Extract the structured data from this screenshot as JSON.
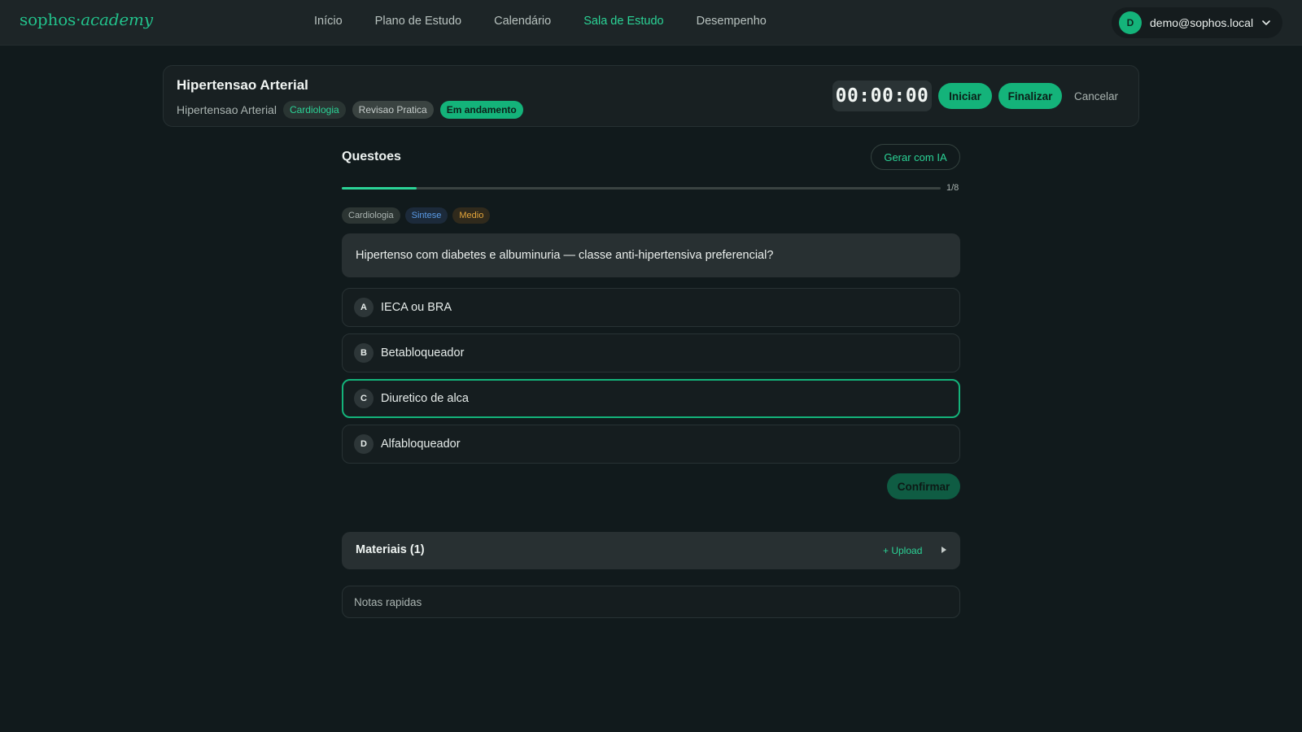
{
  "app": {
    "logo_main": "sophos",
    "logo_sep": "·",
    "logo_accent": "academy"
  },
  "nav": {
    "items": [
      "Início",
      "Plano de Estudo",
      "Calendário",
      "Sala de Estudo",
      "Desempenho"
    ],
    "active": "Sala de Estudo"
  },
  "user": {
    "initial": "D",
    "email": "demo@sophos.local"
  },
  "session": {
    "title": "Hipertensao Arterial",
    "subtitle": "Hipertensao Arterial",
    "chips": {
      "specialty": "Cardiologia",
      "mode": "Revisao Pratica",
      "status": "Em andamento"
    },
    "timer": "00:00:00",
    "start_label": "Iniciar",
    "finish_label": "Finalizar",
    "cancel_label": "Cancelar"
  },
  "questions": {
    "heading": "Questoes",
    "ai_button": "Gerar com IA",
    "progress_text": "1/8",
    "progress_fraction": 0.125,
    "tags": {
      "specialty": "Cardiologia",
      "type": "Sintese",
      "difficulty": "Medio"
    },
    "question_text": "Hipertenso com diabetes e albuminuria — classe anti-hipertensiva preferencial?",
    "options": [
      {
        "letter": "A",
        "text": "IECA ou BRA"
      },
      {
        "letter": "B",
        "text": "Betabloqueador"
      },
      {
        "letter": "C",
        "text": "Diuretico de alca"
      },
      {
        "letter": "D",
        "text": "Alfabloqueador"
      }
    ],
    "selected_letter": "C",
    "confirm_label": "Confirmar"
  },
  "materials": {
    "title": "Materiais (1)",
    "upload_label": "+ Upload"
  },
  "notes": {
    "placeholder": "Notas rapidas"
  },
  "colors": {
    "accent": "#14b37a",
    "accent_text": "#2bd396",
    "background": "#111a1c"
  }
}
